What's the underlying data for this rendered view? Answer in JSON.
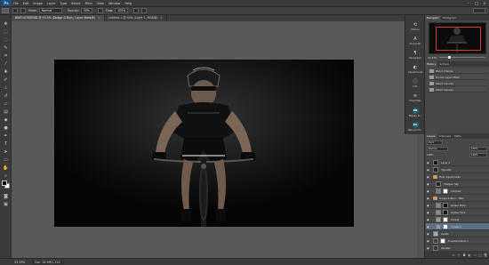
{
  "app": {
    "menu": [
      "File",
      "Edit",
      "Image",
      "Layer",
      "Type",
      "Select",
      "Filter",
      "View",
      "Window",
      "Help"
    ],
    "window_controls": [
      "–",
      "□",
      "×"
    ]
  },
  "options_bar": {
    "mode_label": "Mode:",
    "mode_value": "Normal",
    "opacity_label": "Opacity:",
    "opacity_value": "30%",
    "flow_label": "Flow:",
    "flow_value": "100%"
  },
  "document_tabs": [
    {
      "label": "BIKEOUTDEEND @ 33.3% (Dodge & Burn, Layer Mask/8)",
      "active": true
    },
    {
      "label": "Untitled-1 @ 50% (Layer 1, RGB/8)",
      "active": false
    }
  ],
  "status": {
    "zoom": "33.33%",
    "doc": "Doc: 28.9M/1.31G"
  },
  "collapsed_panels": [
    {
      "label": "History",
      "icon": "history-icon"
    },
    {
      "label": "Character",
      "icon": "character-icon"
    },
    {
      "label": "Paragraph",
      "icon": "paragraph-icon"
    },
    {
      "label": "Adjustments",
      "icon": "adjustments-icon"
    },
    {
      "label": "Info",
      "icon": "info-icon"
    },
    {
      "label": "Properties",
      "icon": "properties-icon"
    },
    {
      "label": "Beauty R...",
      "icon": "beauty-retouch-icon",
      "badge": "BR"
    },
    {
      "label": "Retouch Pi...",
      "icon": "retouch-panel-icon",
      "badge": "RA"
    }
  ],
  "navigator": {
    "tabs": [
      "Navigator",
      "Histogram"
    ],
    "zoom": "33.33%"
  },
  "history": {
    "tabs": [
      "History",
      "Actions"
    ],
    "items": [
      "Blend Change",
      "Double Layer Mask",
      "Select Canvas",
      "Select Canvas"
    ]
  },
  "layers": {
    "tabs": [
      "Layers",
      "Channels",
      "Paths"
    ],
    "kind": "Kind",
    "blend_mode": "Normal",
    "opacity": "100%",
    "fill": "100%",
    "lock_label": "Lock:",
    "items": [
      {
        "name": "Layer 1",
        "type": "layer"
      },
      {
        "name": "Vignette",
        "type": "layer"
      },
      {
        "name": "Final Adjustments",
        "type": "group"
      },
      {
        "name": "Sharpen Sky",
        "type": "layer"
      },
      {
        "name": "Contrast",
        "type": "layer"
      },
      {
        "name": "Dodge & Burn - Main",
        "type": "group"
      },
      {
        "name": "Darker Body",
        "type": "layer"
      },
      {
        "name": "Lighter Face",
        "type": "layer"
      },
      {
        "name": "Curves",
        "type": "layer"
      },
      {
        "name": "Curves 1",
        "type": "layer",
        "selected": true
      },
      {
        "name": "Levels",
        "type": "layer"
      },
      {
        "name": "Hue/Saturation 1",
        "type": "layer"
      },
      {
        "name": "Sandals",
        "type": "group"
      },
      {
        "name": "Smart Filters",
        "type": "layer"
      },
      {
        "name": "Gaussian Blur",
        "type": "layer"
      },
      {
        "name": "Background",
        "type": "layer"
      }
    ]
  },
  "colors": {
    "accent_selected": "#5b6f86",
    "panel_bg": "#474747",
    "canvas_bg": "#595959",
    "nav_frame": "#dd3333"
  }
}
